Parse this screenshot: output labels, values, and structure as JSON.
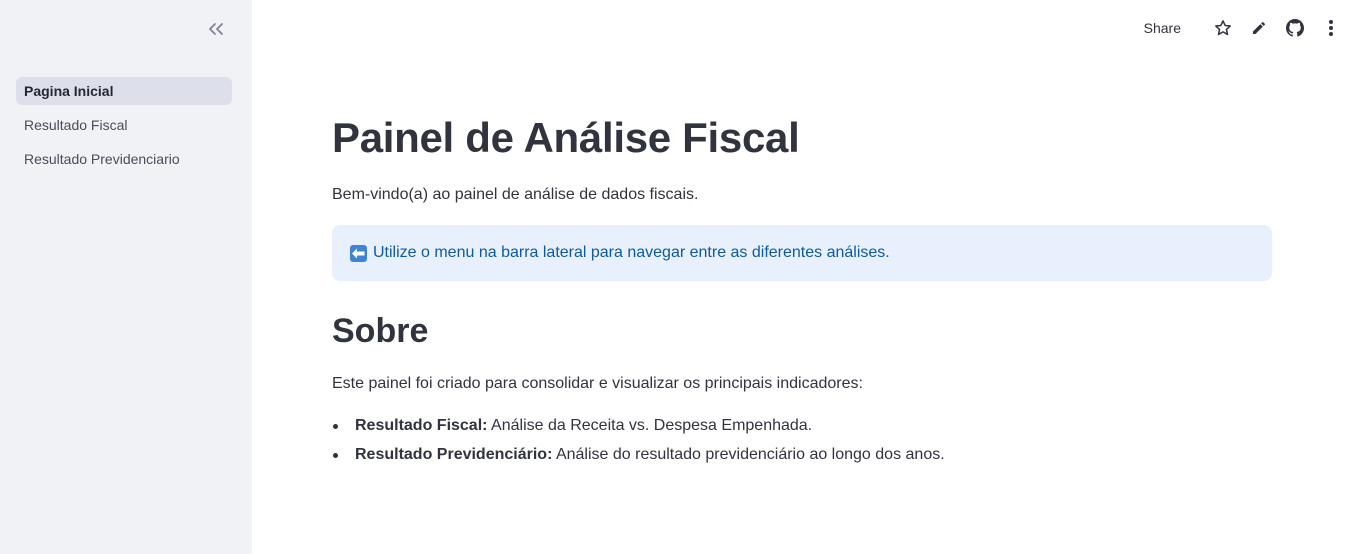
{
  "sidebar": {
    "items": [
      {
        "label": "Pagina Inicial",
        "active": true
      },
      {
        "label": "Resultado Fiscal",
        "active": false
      },
      {
        "label": "Resultado Previdenciario",
        "active": false
      }
    ]
  },
  "toolbar": {
    "share_label": "Share",
    "icons": [
      "star-icon",
      "pencil-icon",
      "github-icon",
      "more-vertical-icon"
    ]
  },
  "main": {
    "title": "Painel de Análise Fiscal",
    "intro": "Bem-vindo(a) ao painel de análise de dados fiscais.",
    "info": {
      "icon": "left-arrow-emoji",
      "text": "Utilize o menu na barra lateral para navegar entre as diferentes análises."
    },
    "section_title": "Sobre",
    "section_desc": "Este painel foi criado para consolidar e visualizar os principais indicadores:",
    "bullets": [
      {
        "label": "Resultado Fiscal:",
        "text": " Análise da Receita vs. Despesa Empenhada."
      },
      {
        "label": "Resultado Previdenciário:",
        "text": " Análise do resultado previdenciário ao longo dos anos."
      }
    ]
  },
  "colors": {
    "sidebar_bg": "#f0f2f6",
    "active_item_bg": "#dde0ea",
    "info_bg": "#e7f0fc",
    "info_text": "#0f5a9c",
    "text": "#31333f"
  }
}
